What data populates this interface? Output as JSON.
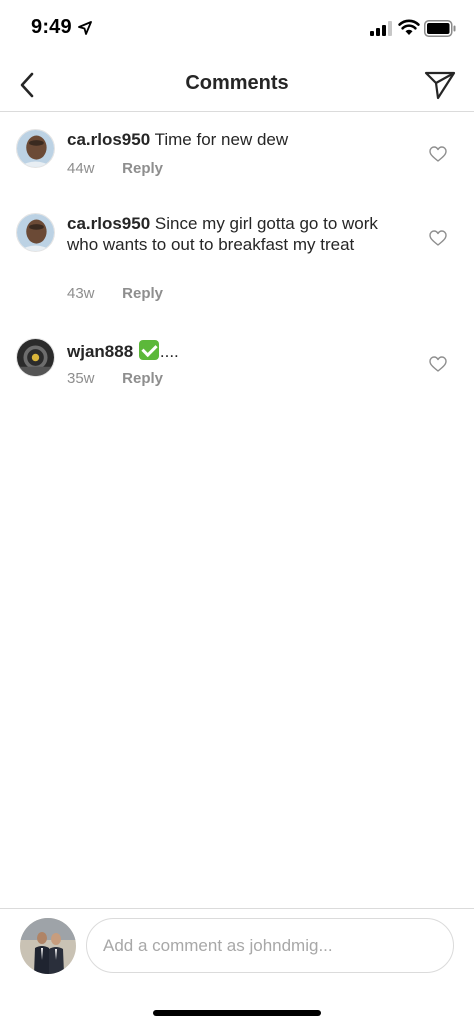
{
  "status_bar": {
    "time": "9:49",
    "icons": [
      "location-arrow-icon",
      "cellular-signal-icon",
      "wifi-icon",
      "battery-icon"
    ]
  },
  "nav": {
    "title": "Comments",
    "back_icon": "chevron-left-icon",
    "share_icon": "paper-plane-icon"
  },
  "comments": [
    {
      "username": "ca.rlos950",
      "text": "Time for new dew",
      "time": "44w",
      "reply_label": "Reply"
    },
    {
      "username": "ca.rlos950",
      "text": "Since my girl gotta go to work who wants to out to breakfast my treat",
      "time": "43w",
      "reply_label": "Reply"
    },
    {
      "username": "wjan888",
      "text_suffix": "....",
      "emoji": "white-check-mark-emoji",
      "time": "35w",
      "reply_label": "Reply"
    }
  ],
  "composer": {
    "placeholder": "Add a comment as johndmig..."
  },
  "colors": {
    "text": "#262626",
    "secondary_text": "#8e8e8e",
    "divider": "#dbdbdb",
    "check_emoji": "#5cb83a"
  }
}
